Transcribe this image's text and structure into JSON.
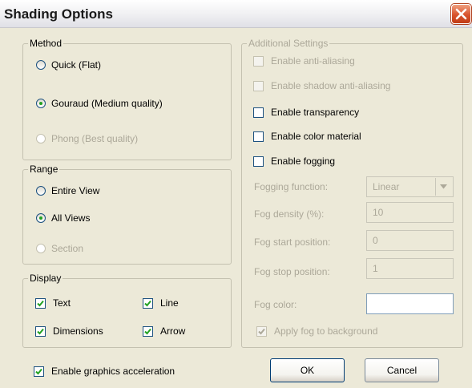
{
  "window": {
    "title": "Shading Options"
  },
  "method": {
    "legend": "Method",
    "options": [
      {
        "label": "Quick (Flat)",
        "selected": false,
        "enabled": true
      },
      {
        "label": "Gouraud (Medium quality)",
        "selected": true,
        "enabled": true
      },
      {
        "label": "Phong (Best quality)",
        "selected": false,
        "enabled": false
      }
    ]
  },
  "range": {
    "legend": "Range",
    "options": [
      {
        "label": "Entire View",
        "selected": false,
        "enabled": true
      },
      {
        "label": "All Views",
        "selected": true,
        "enabled": true
      },
      {
        "label": "Section",
        "selected": false,
        "enabled": false
      }
    ]
  },
  "display": {
    "legend": "Display",
    "items": [
      {
        "label": "Text",
        "checked": true
      },
      {
        "label": "Line",
        "checked": true
      },
      {
        "label": "Dimensions",
        "checked": true
      },
      {
        "label": "Arrow",
        "checked": true
      }
    ]
  },
  "acceleration": {
    "label": "Enable graphics acceleration",
    "checked": true
  },
  "additional": {
    "legend": "Additional Settings",
    "checks": [
      {
        "label": "Enable anti-aliasing",
        "checked": false,
        "enabled": false
      },
      {
        "label": "Enable shadow anti-aliasing",
        "checked": false,
        "enabled": false
      },
      {
        "label": "Enable transparency",
        "checked": false,
        "enabled": true
      },
      {
        "label": "Enable color material",
        "checked": false,
        "enabled": true
      },
      {
        "label": "Enable fogging",
        "checked": false,
        "enabled": true
      }
    ],
    "fog": {
      "function_label": "Fogging function:",
      "function_value": "Linear",
      "density_label": "Fog density (%):",
      "density_value": "10",
      "start_label": "Fog start position:",
      "start_value": "0",
      "stop_label": "Fog stop position:",
      "stop_value": "1",
      "color_label": "Fog color:",
      "color_value": "#ffffff",
      "background_label": "Apply fog to background",
      "background_checked": true
    }
  },
  "buttons": {
    "ok": "OK",
    "cancel": "Cancel"
  },
  "colors": {
    "radio_dot": "#21a121",
    "check_mark": "#21a121",
    "close_button": "#d8532d"
  }
}
